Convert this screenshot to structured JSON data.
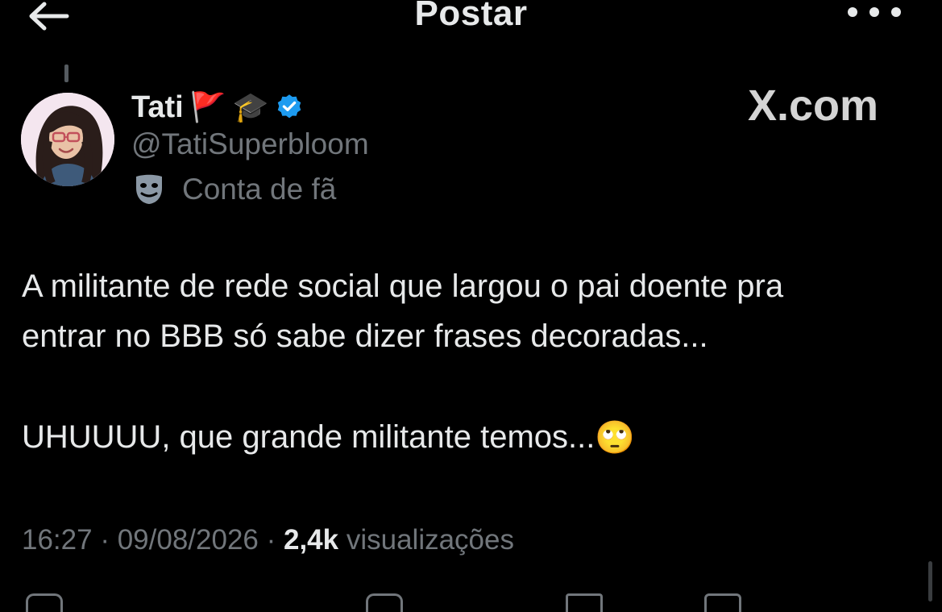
{
  "header": {
    "title": "Postar",
    "back_icon": "arrow-left-icon",
    "more_icon": "more-horizontal-icon"
  },
  "author": {
    "name": "Tati",
    "emoji_flag": "🚩",
    "emoji_cap": "🎓",
    "verified_icon": "verified-badge-icon",
    "handle": "@TatiSuperbloom",
    "label_icon": "theater-mask-icon",
    "label": "Conta de fã"
  },
  "watermark": "X.com",
  "post": {
    "line1": "A militante de rede social que largou o pai doente pra",
    "line2": "entrar no BBB só sabe dizer frases decoradas...",
    "line3": "UHUUUU, que grande militante temos...",
    "emoji": "🙄"
  },
  "meta": {
    "time": "16:27",
    "sep1": " · ",
    "date": "09/08/2026",
    "sep2": " · ",
    "views_count": "2,4k",
    "views_label": " visualizações"
  },
  "colors": {
    "background": "#000000",
    "text_primary": "#e7e9ea",
    "text_secondary": "#71767b",
    "verified": "#1d9bf0"
  }
}
